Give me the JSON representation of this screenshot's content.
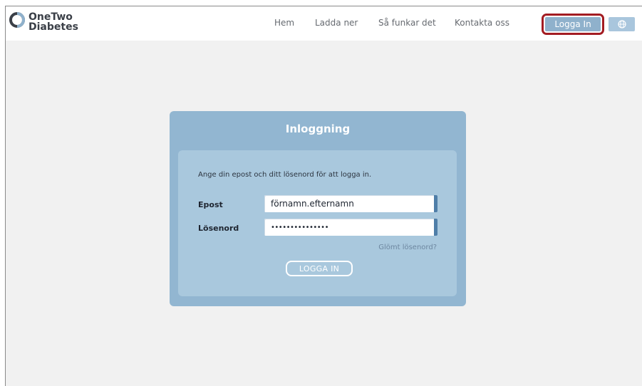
{
  "header": {
    "logo": {
      "line1": "OneTwo",
      "line2": "Diabetes"
    },
    "nav": [
      {
        "label": "Hem"
      },
      {
        "label": "Ladda ner"
      },
      {
        "label": "Så funkar det"
      },
      {
        "label": "Kontakta oss"
      }
    ],
    "login_button": "Logga In",
    "language_icon": "globe-icon"
  },
  "login": {
    "title": "Inloggning",
    "instructions": "Ange din epost och ditt lösenord för att logga in.",
    "email_label": "Epost",
    "email_value": "förnamn.efternamn",
    "password_label": "Lösenord",
    "password_value": "•••••••••••••••",
    "forgot_link": "Glömt lösenord?",
    "submit_label": "LOGGA IN"
  },
  "colors": {
    "card": "#92b6d1",
    "inner": "#a9c8dd",
    "highlight_outline": "#a31c22",
    "field_accent": "#4f7ea8"
  }
}
